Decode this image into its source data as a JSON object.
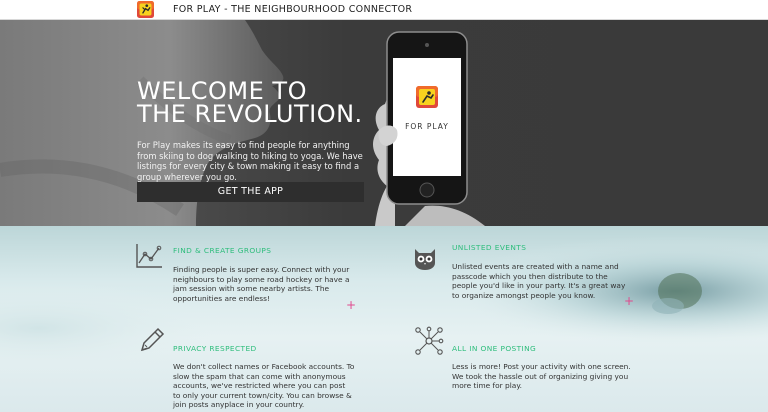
{
  "header": {
    "title": "FOR PLAY - THE NEIGHBOURHOOD CONNECTOR"
  },
  "hero": {
    "heading_line1": "WELCOME TO",
    "heading_line2": "THE REVOLUTION.",
    "intro": "For Play makes its easy to find people for anything from skiing to dog walking to hiking to yoga. We have listings for every city & town making it easy to find a group wherever you go.",
    "cta_label": "GET THE APP",
    "phone_app_name": "FOR PLAY"
  },
  "features": [
    {
      "icon": "line-graph-icon",
      "title": "FIND & CREATE GROUPS",
      "body": "Finding people is super easy. Connect with your neighbours to play some road hockey or have a jam session with some nearby artists. The opportunities are endless!"
    },
    {
      "icon": "owl-icon",
      "title": "UNLISTED EVENTS",
      "body": "Unlisted events are created with a name and passcode which you then distribute to the people you'd like in your party. It's a great way to organize amongst people you know."
    },
    {
      "icon": "pencil-icon",
      "title": "PRIVACY RESPECTED",
      "body": "We don't collect names or Facebook accounts. To slow the spam that can come with anonymous accounts, we've restricted where you can post to only your current town/city. You can browse & join posts anyplace in your country."
    },
    {
      "icon": "network-icon",
      "title": "ALL IN ONE POSTING",
      "body": "Less is more! Post your activity with one screen. We took the hassle out of organizing giving you more time for play."
    }
  ],
  "colors": {
    "accent_green": "#2ebd7c",
    "accent_pink": "#e04a8e",
    "hero_dark": "#3a3a3a"
  }
}
